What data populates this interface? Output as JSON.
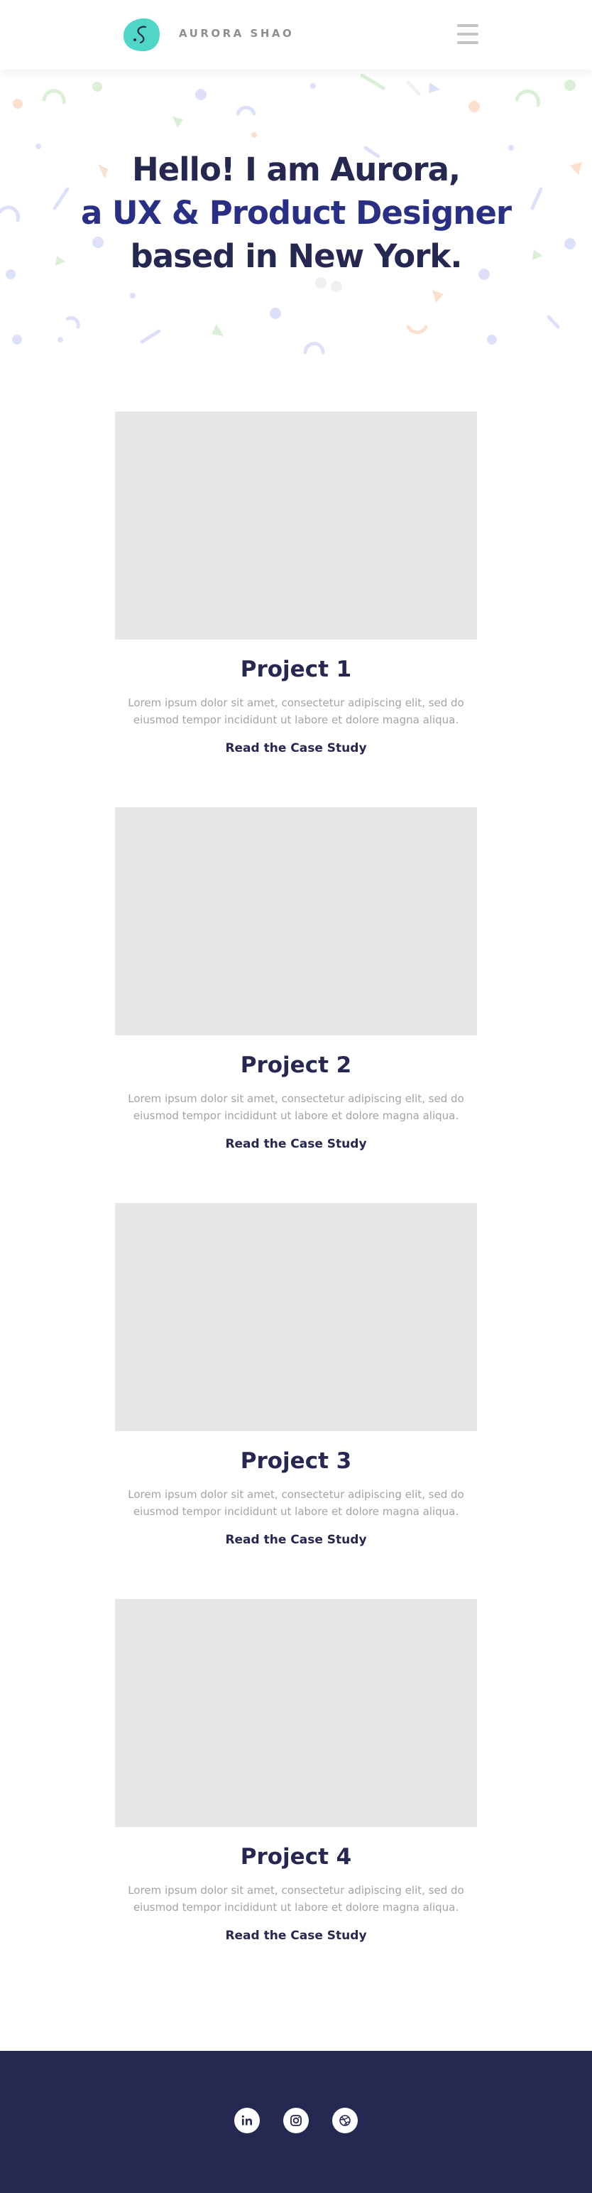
{
  "header": {
    "brand": "AURORA SHAO",
    "logo_icon": "aurora-logo-icon",
    "menu_icon": "hamburger-menu-icon"
  },
  "hero": {
    "line1": "Hello! I am Aurora,",
    "line2": "a UX & Product Designer",
    "line3": "based in New York."
  },
  "projects": [
    {
      "title": "Project 1",
      "description": "Lorem ipsum dolor sit amet, consectetur adipiscing elit, sed do eiusmod tempor incididunt ut labore et dolore magna aliqua.",
      "cta": "Read the Case Study"
    },
    {
      "title": "Project 2",
      "description": "Lorem ipsum dolor sit amet, consectetur adipiscing elit, sed do eiusmod tempor incididunt ut labore et dolore magna aliqua.",
      "cta": "Read the Case Study"
    },
    {
      "title": "Project 3",
      "description": "Lorem ipsum dolor sit amet, consectetur adipiscing elit, sed do eiusmod tempor incididunt ut labore et dolore magna aliqua.",
      "cta": "Read the Case Study"
    },
    {
      "title": "Project 4",
      "description": "Lorem ipsum dolor sit amet, consectetur adipiscing elit, sed do eiusmod tempor incididunt ut labore et dolore magna aliqua.",
      "cta": "Read the Case Study"
    }
  ],
  "footer": {
    "socials": [
      "linkedin-icon",
      "instagram-icon",
      "dribbble-icon"
    ]
  },
  "colors": {
    "navy": "#252850",
    "accent_blue": "#2a2f86",
    "logo_teal": "#4fd6c7",
    "placeholder_gray": "#e6e6e6",
    "muted_text": "#a3a3a8"
  }
}
